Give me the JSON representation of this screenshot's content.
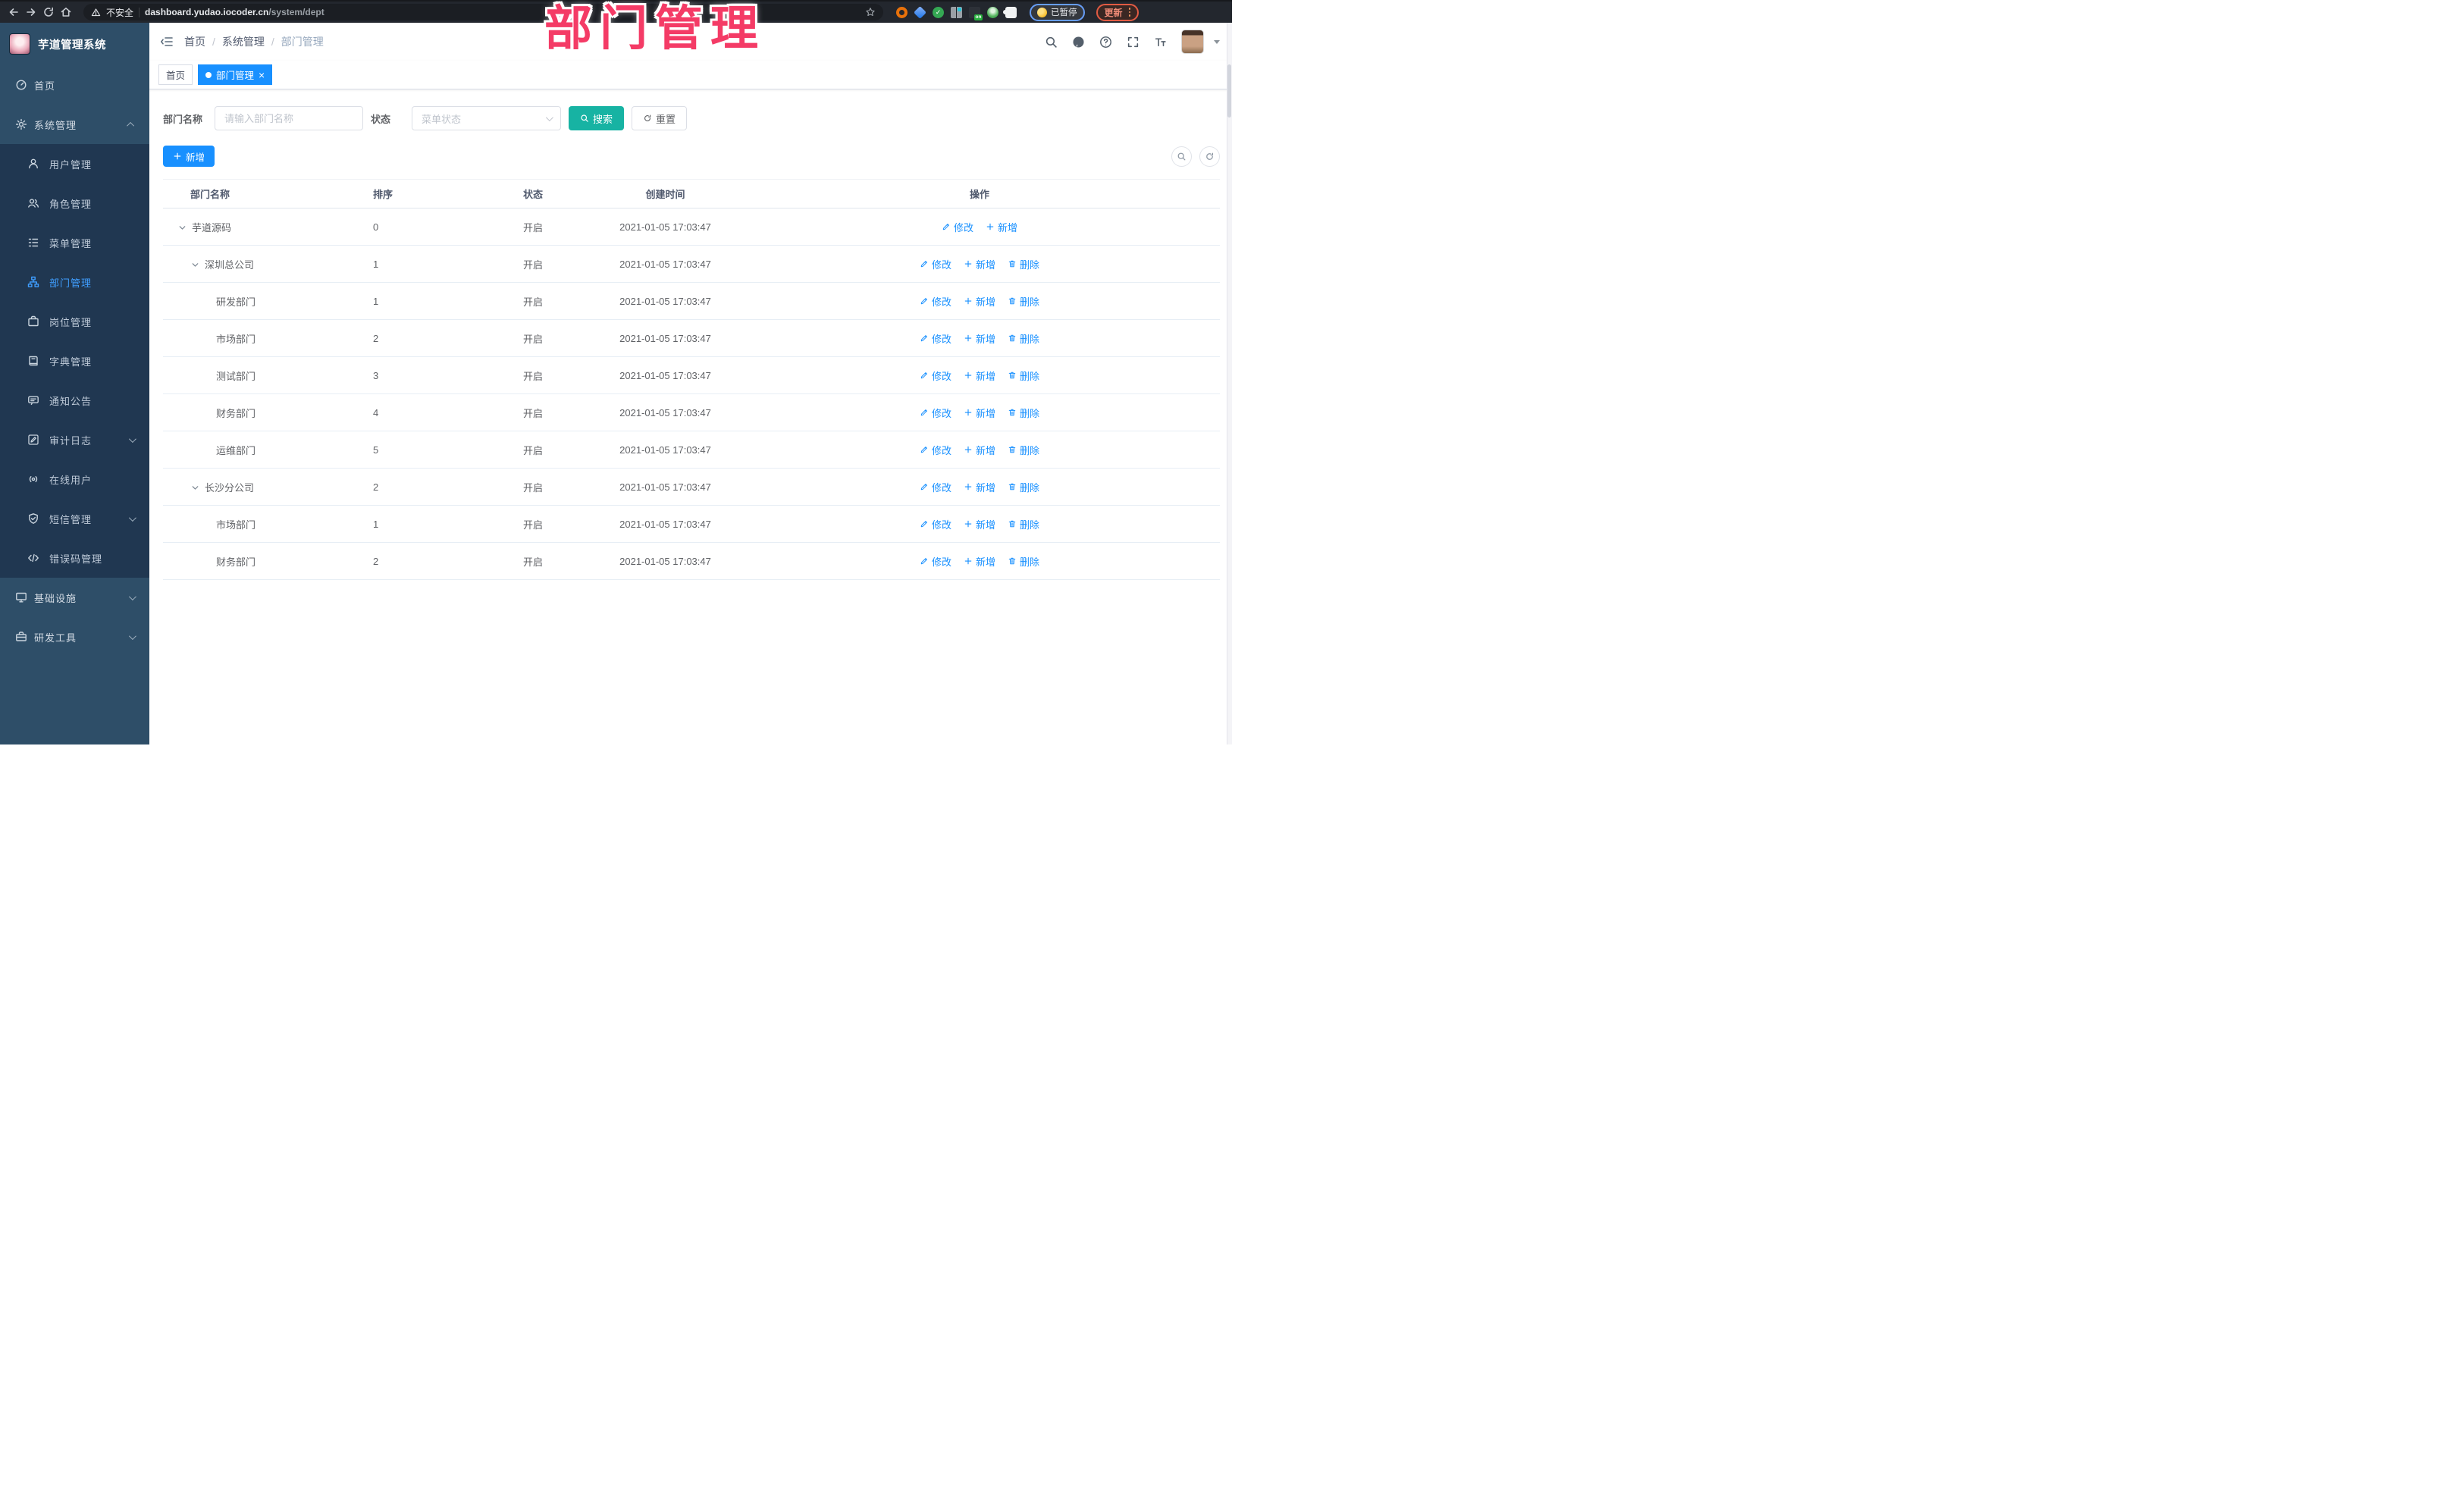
{
  "browser": {
    "security_label": "不安全",
    "url_host": "dashboard.yudao.iocoder.cn",
    "url_path": "/system/dept",
    "extension_badge": "on",
    "profile_status": "已暂停",
    "update_label": "更新"
  },
  "sidebar": {
    "title": "芋道管理系统",
    "items": [
      {
        "label": "首页",
        "icon": "dashboard-icon"
      },
      {
        "label": "系统管理",
        "icon": "gear-icon"
      },
      {
        "label": "用户管理",
        "icon": "user-icon"
      },
      {
        "label": "角色管理",
        "icon": "users-icon"
      },
      {
        "label": "菜单管理",
        "icon": "menu-list-icon"
      },
      {
        "label": "部门管理",
        "icon": "org-tree-icon"
      },
      {
        "label": "岗位管理",
        "icon": "briefcase-icon"
      },
      {
        "label": "字典管理",
        "icon": "book-icon"
      },
      {
        "label": "通知公告",
        "icon": "announcement-icon"
      },
      {
        "label": "审计日志",
        "icon": "log-icon"
      },
      {
        "label": "在线用户",
        "icon": "online-icon"
      },
      {
        "label": "短信管理",
        "icon": "sms-shield-icon"
      },
      {
        "label": "错误码管理",
        "icon": "code-icon"
      },
      {
        "label": "基础设施",
        "icon": "monitor-icon"
      },
      {
        "label": "研发工具",
        "icon": "toolbox-icon"
      }
    ]
  },
  "header": {
    "breadcrumb": [
      "首页",
      "系统管理",
      "部门管理"
    ]
  },
  "tabs": [
    {
      "label": "首页"
    },
    {
      "label": "部门管理",
      "close": "×"
    }
  ],
  "annotation": {
    "text": "部门管理",
    "color": "#f43b66"
  },
  "filters": {
    "name_label": "部门名称",
    "name_placeholder": "请输入部门名称",
    "status_label": "状态",
    "status_placeholder": "菜单状态",
    "search_label": "搜索",
    "reset_label": "重置"
  },
  "toolbar": {
    "add_label": "新增"
  },
  "actions": {
    "edit": "修改",
    "add": "新增",
    "delete": "删除"
  },
  "table": {
    "columns": [
      "部门名称",
      "排序",
      "状态",
      "创建时间",
      "操作"
    ],
    "rows": [
      {
        "name": "芋道源码",
        "sort": "0",
        "status": "开启",
        "created": "2021-01-05 17:03:47"
      },
      {
        "name": "深圳总公司",
        "sort": "1",
        "status": "开启",
        "created": "2021-01-05 17:03:47"
      },
      {
        "name": "研发部门",
        "sort": "1",
        "status": "开启",
        "created": "2021-01-05 17:03:47"
      },
      {
        "name": "市场部门",
        "sort": "2",
        "status": "开启",
        "created": "2021-01-05 17:03:47"
      },
      {
        "name": "测试部门",
        "sort": "3",
        "status": "开启",
        "created": "2021-01-05 17:03:47"
      },
      {
        "name": "财务部门",
        "sort": "4",
        "status": "开启",
        "created": "2021-01-05 17:03:47"
      },
      {
        "name": "运维部门",
        "sort": "5",
        "status": "开启",
        "created": "2021-01-05 17:03:47"
      },
      {
        "name": "长沙分公司",
        "sort": "2",
        "status": "开启",
        "created": "2021-01-05 17:03:47"
      },
      {
        "name": "市场部门",
        "sort": "1",
        "status": "开启",
        "created": "2021-01-05 17:03:47"
      },
      {
        "name": "财务部门",
        "sort": "2",
        "status": "开启",
        "created": "2021-01-05 17:03:47"
      }
    ]
  }
}
